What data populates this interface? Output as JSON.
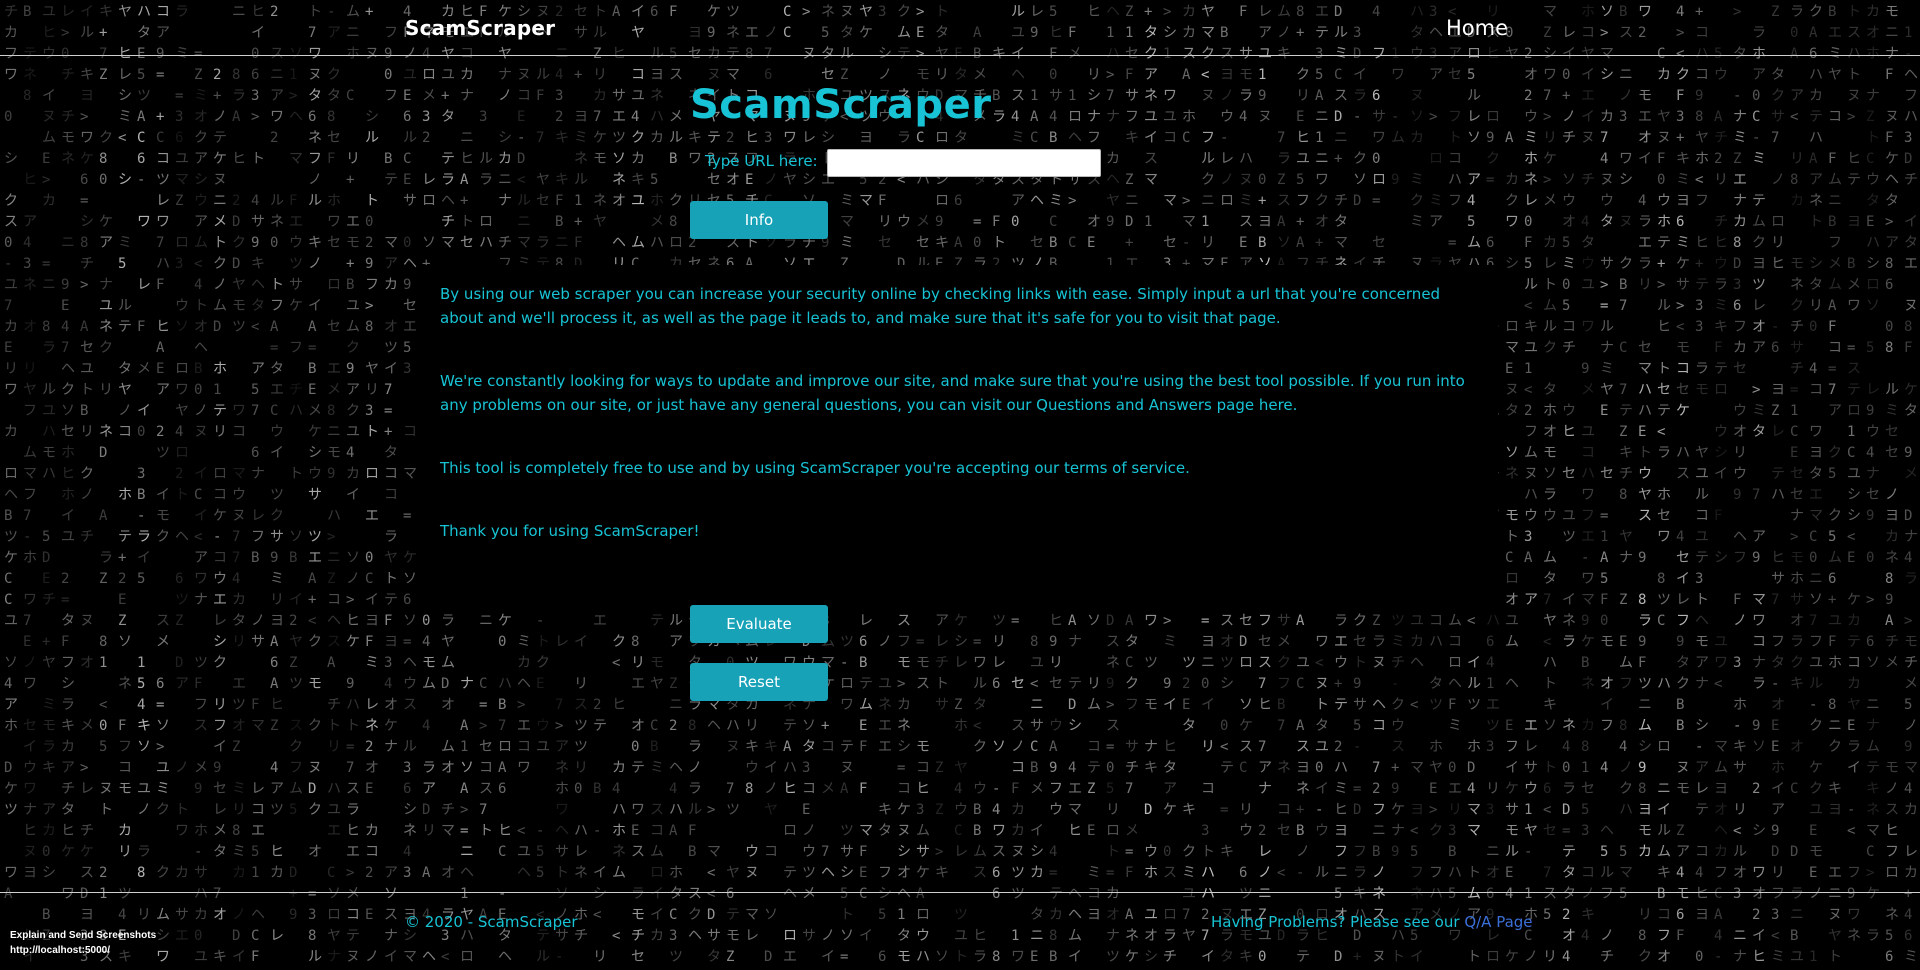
{
  "nav": {
    "brand": "ScamScraper",
    "home_label": "Home"
  },
  "main": {
    "title": "ScamScraper",
    "url_label": "Type URL here:",
    "url_value": "",
    "info_button": "Info",
    "evaluate_button": "Evaluate",
    "reset_button": "Reset"
  },
  "info": {
    "paragraphs": [
      "By using our web scraper you can increase your security online by checking links with ease. Simply input a url that you're concerned about and we'll process it, as well as the page it leads to, and make sure that it's safe for you to visit that page.",
      "We're constantly looking for ways to update and improve our site, and make sure that you're using the best tool possible. If you run into any problems on our site, or just have any general questions, you can visit our Questions and Answers page here.",
      "This tool is completely free to use and by using ScamScraper you're accepting our terms of service.",
      "Thank you for using ScamScraper!"
    ]
  },
  "footer": {
    "copyright": "© 2020 - ScamScraper",
    "help_prefix": "Having Problems? Please see our",
    "help_link": "Q/A Page"
  },
  "overlay": {
    "title": "Explain and Send Screenshots",
    "url": "http://localhost:5000/"
  },
  "colors": {
    "accent": "#17c3d4",
    "button": "#17a2b8",
    "link": "#3b6fd8",
    "background": "#000000"
  }
}
